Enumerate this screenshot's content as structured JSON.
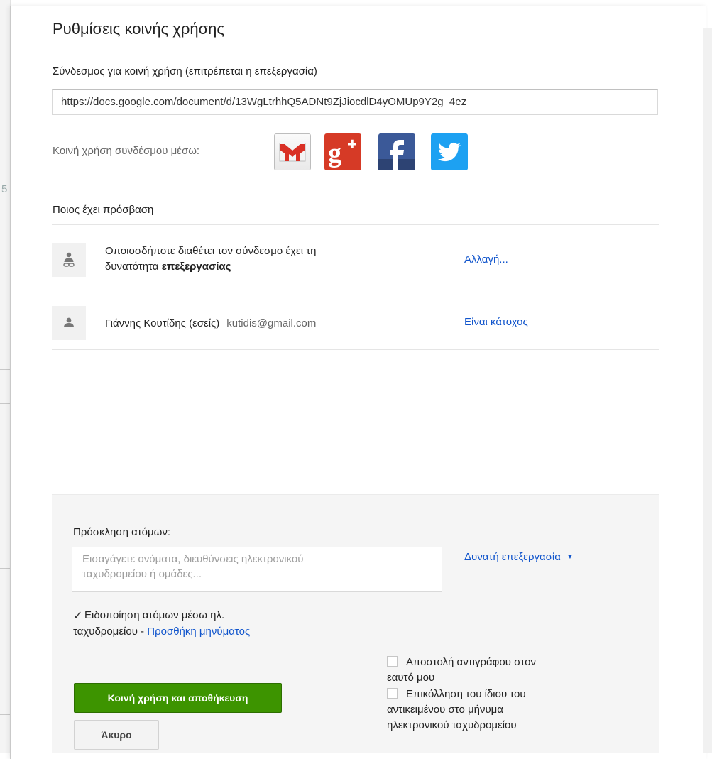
{
  "dialog": {
    "title": "Ρυθμίσεις κοινής χρήσης",
    "link_label": "Σύνδεσμος για κοινή χρήση (επιτρέπεται η επεξεργασία)",
    "link_value": "https://docs.google.com/document/d/13WgLtrhhQ5ADNt9ZjJiocdlD4yOMUp9Y2g_4ez",
    "share_via_label": "Κοινή χρήση συνδέσμου μέσω:",
    "share_icons": [
      "gmail-icon",
      "google-plus-icon",
      "facebook-icon",
      "twitter-icon"
    ]
  },
  "access": {
    "title": "Ποιος έχει πρόσβαση",
    "rows": [
      {
        "icon": "link-person-icon",
        "text_line1": "Οποιοσδήποτε διαθέτει τον σύνδεσμο έχει τη",
        "text_line2_prefix": "δυνατότητα ",
        "text_line2_bold": "επεξεργασίας",
        "action": "Αλλαγή..."
      },
      {
        "icon": "person-icon",
        "name": "Γιάννης Κουτίδης (εσείς)",
        "email": "kutidis@gmail.com",
        "role": "Είναι κάτοχος"
      }
    ]
  },
  "invite": {
    "label": "Πρόσκληση ατόμων:",
    "placeholder_line1": "Εισαγάγετε ονόματα, διευθύνσεις ηλεκτρονικού",
    "placeholder_line2": "ταχυδρομείου ή ομάδες...",
    "permission": "Δυνατή επεξεργασία",
    "notify_line1": "Ειδοποίηση ατόμων μέσω ηλ.",
    "notify_line2_prefix": "ταχυδρομείου - ",
    "add_message": "Προσθήκη μηνύματος",
    "notify_checked": true,
    "send_copy_line1": "Αποστολή αντιγράφου στον",
    "send_copy_line2": "εαυτό μου",
    "paste_line1": "Επικόλληση του ίδιου του",
    "paste_line2": "αντικειμένου στο μήνυμα",
    "paste_line3": "ηλεκτρονικού ταχυδρομείου",
    "share_save": "Κοινή χρήση και αποθήκευση",
    "cancel": "Άκυρο"
  },
  "colors": {
    "link_blue": "#1155cc",
    "primary_green": "#3d9400"
  }
}
